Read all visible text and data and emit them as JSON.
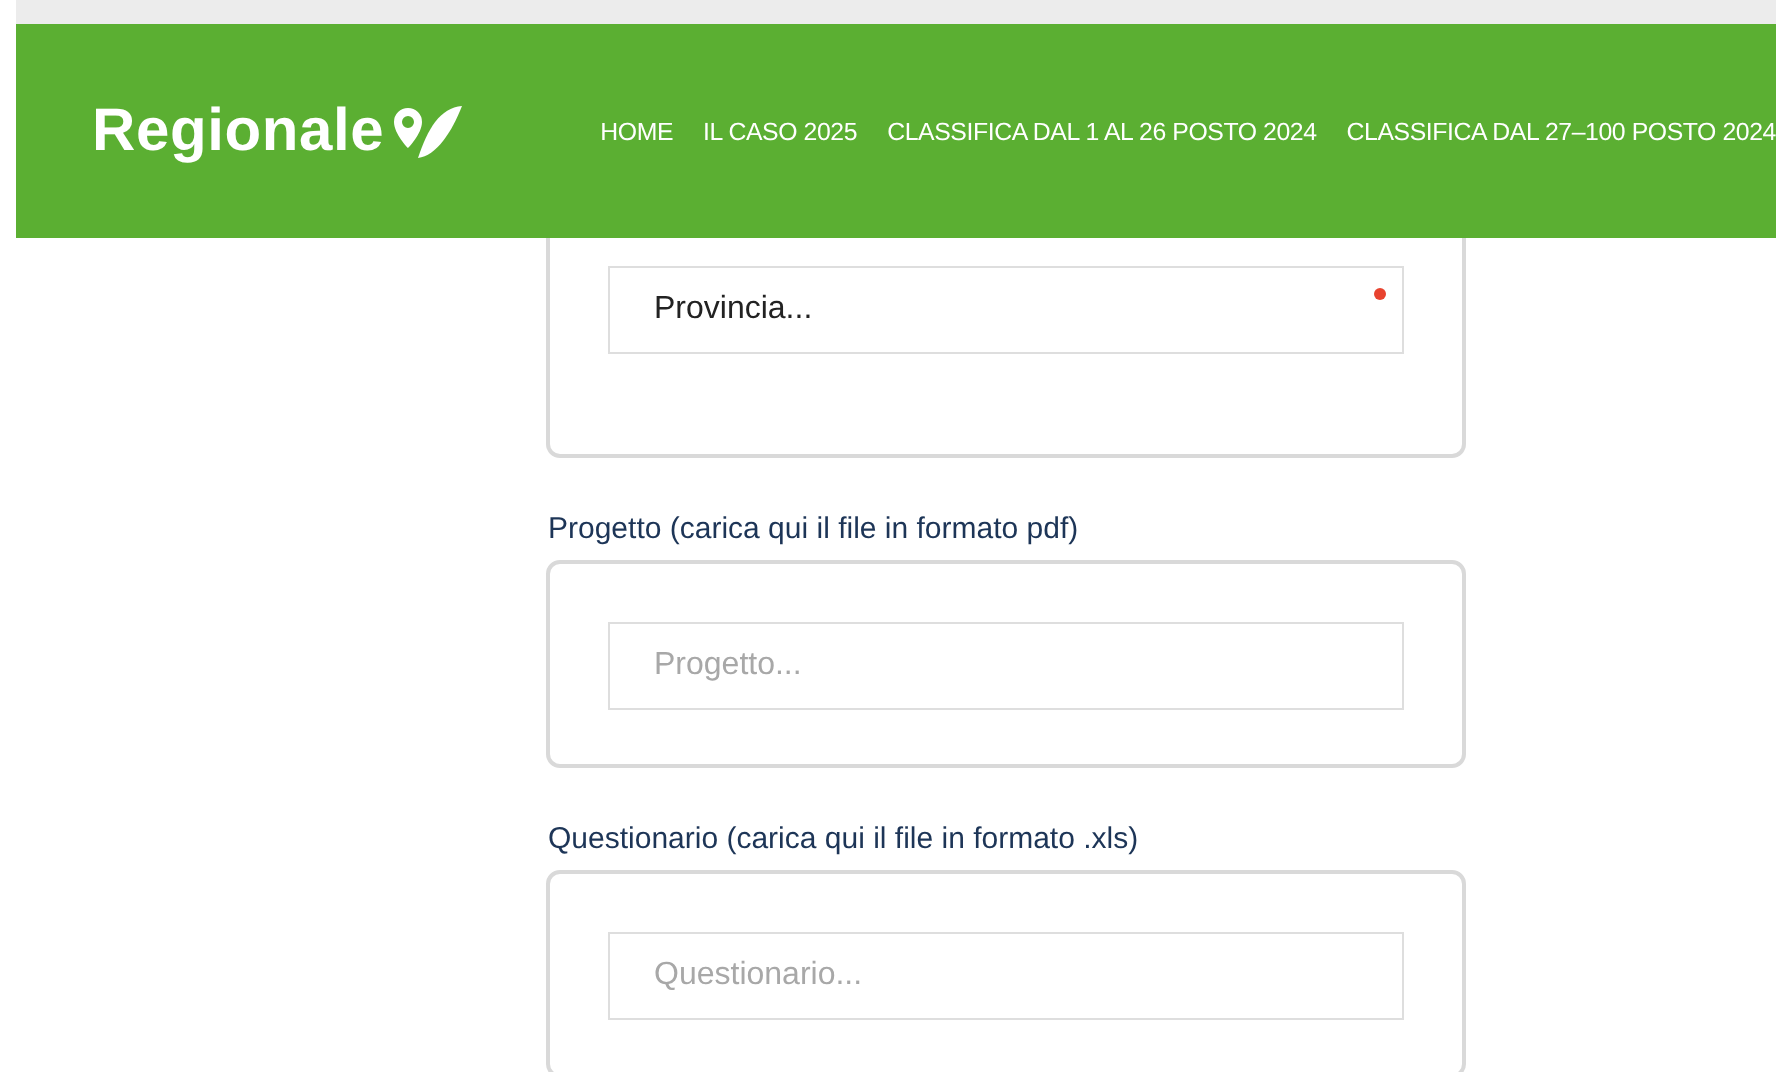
{
  "header": {
    "logo": "Regionale",
    "nav": [
      {
        "label": "HOME"
      },
      {
        "label": "IL CASO 2025"
      },
      {
        "label": "CLASSIFICA DAL 1 AL 26 POSTO 2024"
      },
      {
        "label": "CLASSIFICA DAL 27–100 POSTO 2024"
      }
    ]
  },
  "sections": [
    {
      "field": {
        "value": "Provincia...",
        "required": true
      }
    },
    {
      "label": "Progetto (carica qui il file in formato pdf)",
      "field": {
        "placeholder": "Progetto...",
        "required": false
      }
    },
    {
      "label": "Questionario (carica qui il file in formato .xls)",
      "field": {
        "placeholder": "Questionario...",
        "required": false
      }
    }
  ]
}
